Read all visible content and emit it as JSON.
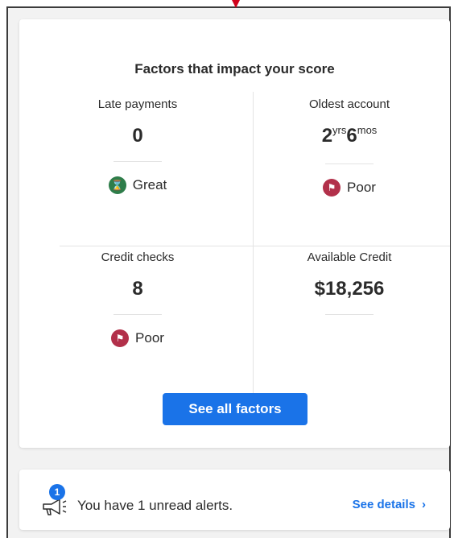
{
  "colors": {
    "accent": "#1a73e8",
    "great": "#2e7d4a",
    "poor": "#b2304a"
  },
  "factors": {
    "title": "Factors that impact your score",
    "items": [
      {
        "label": "Late payments",
        "value": "0",
        "rating": "Great",
        "rating_icon": "hourglass-icon"
      },
      {
        "label": "Oldest account",
        "value_years": "2",
        "years_unit": "yrs",
        "value_months": "6",
        "months_unit": "mos",
        "rating": "Poor",
        "rating_icon": "flag-icon"
      },
      {
        "label": "Credit checks",
        "value": "8",
        "rating": "Poor",
        "rating_icon": "flag-icon"
      },
      {
        "label": "Available Credit",
        "value": "$18,256"
      }
    ],
    "button_label": "See all factors"
  },
  "alerts": {
    "badge_count": "1",
    "text": "You have 1 unread alerts.",
    "link_label": "See details",
    "link_chevron": "›"
  }
}
